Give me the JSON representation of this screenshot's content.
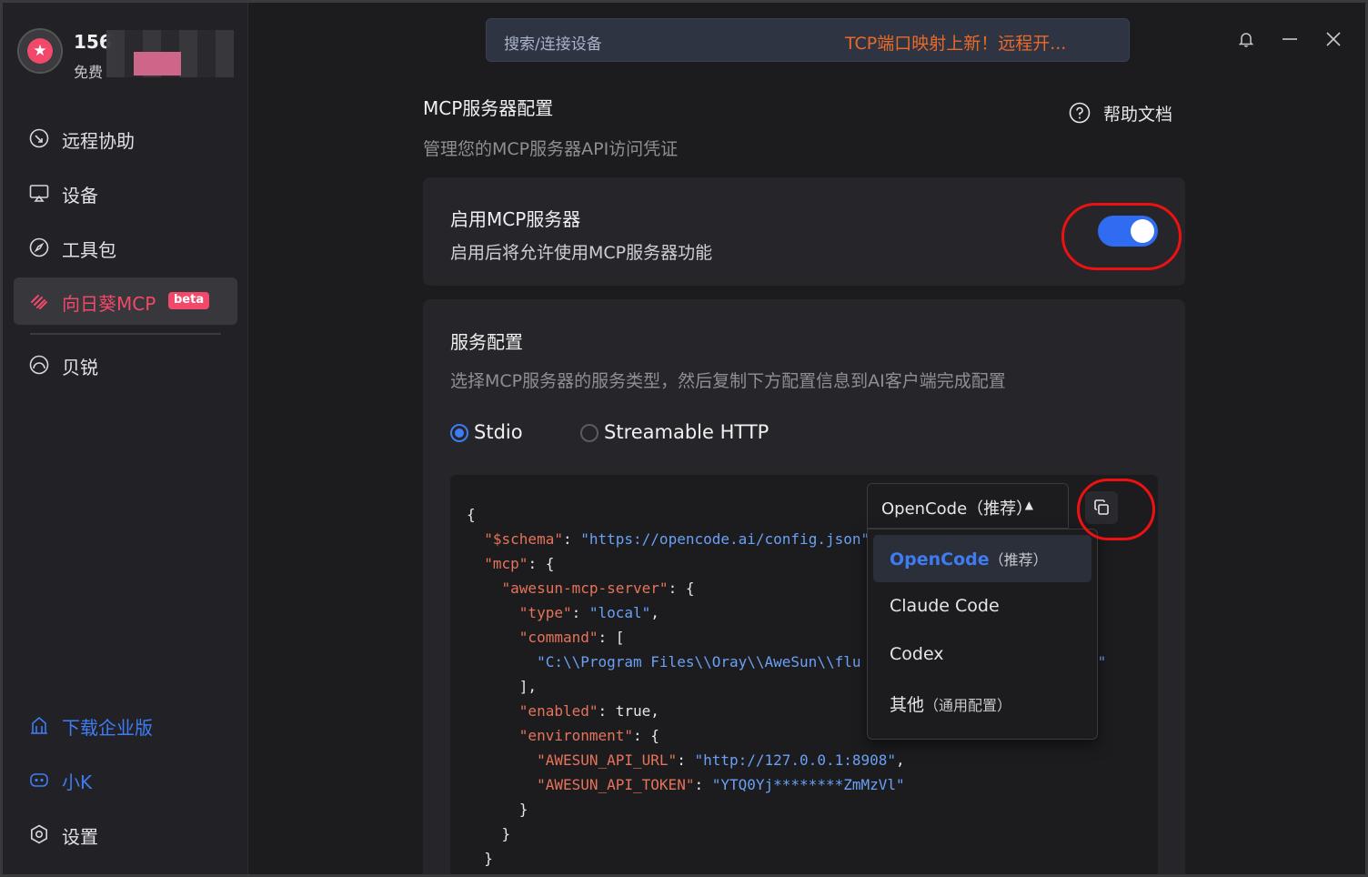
{
  "user": {
    "name": "156",
    "plan": "免费"
  },
  "sidebar": {
    "items": [
      {
        "label": "远程协助",
        "icon": "remote-assist-icon"
      },
      {
        "label": "设备",
        "icon": "monitor-icon"
      },
      {
        "label": "工具包",
        "icon": "compass-icon"
      },
      {
        "label": "向日葵MCP",
        "icon": "mcp-icon",
        "badge": "beta",
        "active": true
      },
      {
        "label": "贝锐",
        "icon": "oray-icon"
      }
    ],
    "bottom": [
      {
        "label": "下载企业版",
        "icon": "building-icon"
      },
      {
        "label": "小K",
        "icon": "robot-icon"
      },
      {
        "label": "设置",
        "icon": "gear-icon"
      }
    ]
  },
  "header": {
    "search_label": "搜索/连接设备",
    "promo": "TCP端口映射上新！远程开..."
  },
  "page": {
    "title": "MCP服务器配置",
    "subtitle": "管理您的MCP服务器API访问凭证",
    "help": "帮助文档"
  },
  "enable_card": {
    "title": "启用MCP服务器",
    "subtitle": "启用后将允许使用MCP服务器功能",
    "enabled": true
  },
  "service_card": {
    "title": "服务配置",
    "subtitle": "选择MCP服务器的服务类型，然后复制下方配置信息到AI客户端完成配置",
    "radio_options": [
      {
        "label": "Stdio",
        "selected": true
      },
      {
        "label": "Streamable HTTP",
        "selected": false
      }
    ]
  },
  "code": {
    "schema_key": "\"$schema\"",
    "schema_val": "\"https://opencode.ai/config.json\"",
    "mcp_key": "\"mcp\"",
    "server_key": "\"awesun-mcp-server\"",
    "type_key": "\"type\"",
    "type_val": "\"local\"",
    "command_key": "\"command\"",
    "command_val_start": "\"C:\\\\Program Files\\\\Oray\\\\AweSun\\\\flu",
    "command_val_end": "xe\"",
    "enabled_key": "\"enabled\"",
    "enabled_val": "true",
    "env_key": "\"environment\"",
    "url_key": "\"AWESUN_API_URL\"",
    "url_val": "\"http://127.0.0.1:8908\"",
    "token_key": "\"AWESUN_API_TOKEN\"",
    "token_val": "\"YTQ0Yj********ZmMzVl\""
  },
  "dropdown": {
    "selected": "OpenCode（推荐）",
    "options": [
      {
        "name": "OpenCode",
        "note": "（推荐）",
        "selected": true
      },
      {
        "name": "Claude Code",
        "note": ""
      },
      {
        "name": "Codex",
        "note": ""
      },
      {
        "name": "其他",
        "note": "（通用配置）"
      }
    ]
  }
}
